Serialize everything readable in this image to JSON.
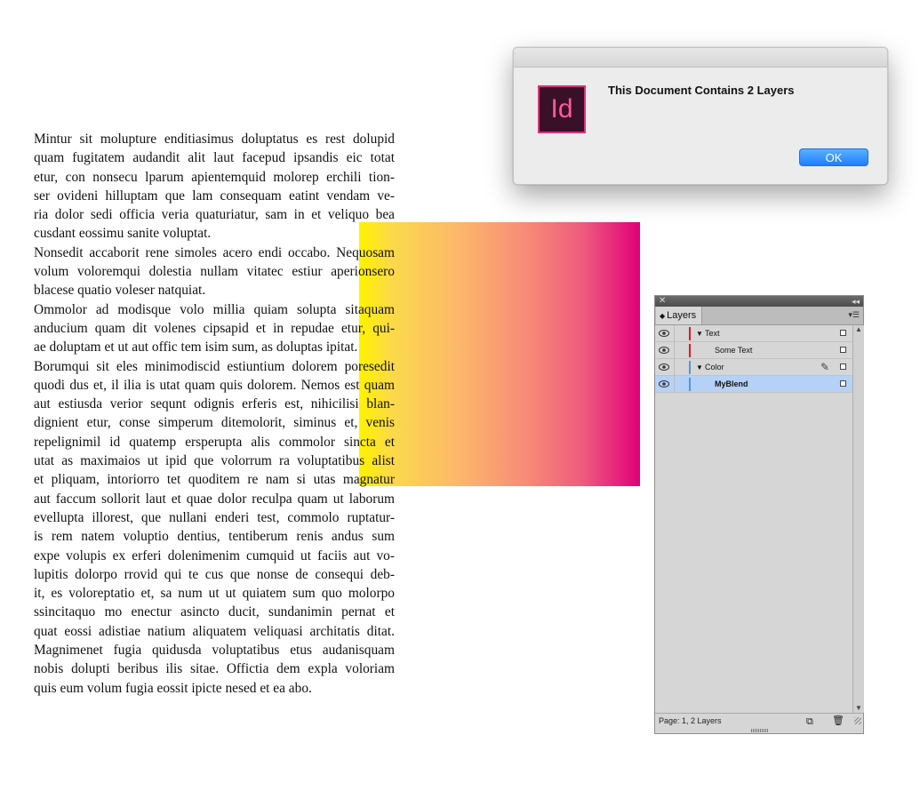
{
  "document": {
    "text_lines": [
      "Mintur sit molupture enditiasimus doluptatus es rest dolupid",
      "quam fugitatem audandit alit laut facepud ipsandis eic totat",
      "etur, con nonsecu lparum apientemquid molorep erchili tion-",
      "ser ovideni hilluptam que lam consequam eatint vendam ve-",
      "ria dolor sedi officia veria quaturiatur, sam in et veliquo bea",
      "cusdant eossimu sanite voluptat.",
      "Nonsedit accaborit rene simoles acero endi occabo. Nequosam",
      "volum voloremqui dolestia nullam vitatec estiur aperionsero",
      "blacese quatio voleser natquiat.",
      "Ommolor ad modisque volo millia quiam solupta sitaquam",
      "anducium quam dit volenes cipsapid et in repudae etur, qui-",
      "ae doluptam et ut aut offic tem isim sum, as doluptas ipitat.",
      "Borumqui sit eles minimodiscid estiuntium dolorem poresedit",
      "quodi dus et, il ilia is utat quam quis dolorem. Nemos est quam",
      "aut estiusda verior sequnt odignis erferis est, nihicilisi blan-",
      "dignient etur, conse simperum ditemolorit, siminus et, venis",
      "repelignimil id quatemp ersperupta alis commolor sincta et",
      "utat as maximaios ut ipid que volorrum ra voluptatibus alist",
      "et pliquam, intoriorro tet quoditem re nam si utas magnatur",
      "aut faccum sollorit laut et quae dolor reculpa quam ut laborum",
      "evellupta illorest, que nullani enderi test, commolo ruptatur-",
      "is rem natem voluptio dentius, tentiberum renis andus sum",
      "expe volupis ex erferi dolenimenim cumquid ut faciis aut vo-",
      "lupitis dolorpo rrovid qui te cus que nonse de consequi deb-",
      "it, es voloreptatio et, sa num ut ut quiatem sum quo molorpo",
      "ssincitaquo mo enectur asincto ducit, sundanimin pernat et",
      "quat eossi adistiae natium aliquatem veliquasi architatis ditat.",
      "Magnimenet fugia quidusda voluptatibus etus audanisquam",
      "nobis dolupti beribus ilis sitae. Offictia dem expla voloriam",
      "quis eum volum fugia eossit ipicte nesed et ea abo."
    ],
    "paragraph_ends": [
      5,
      8,
      11,
      29
    ],
    "blend_colors": [
      "#fff200",
      "#e0007a"
    ]
  },
  "dialog": {
    "app_icon_text": "Id",
    "message": "This Document Contains 2 Layers",
    "ok_label": "OK"
  },
  "layers_panel": {
    "tab_label": "Layers",
    "rows": [
      {
        "label": "Text",
        "indent": 0,
        "expanded": true,
        "color": "#e8141e",
        "selected": false,
        "bold": false,
        "pen": false
      },
      {
        "label": "Some Text",
        "indent": 1,
        "expanded": false,
        "color": "#e8141e",
        "selected": false,
        "bold": false,
        "pen": false
      },
      {
        "label": "Color",
        "indent": 0,
        "expanded": true,
        "color": "#4f95e6",
        "selected": false,
        "bold": false,
        "pen": true
      },
      {
        "label": "MyBlend",
        "indent": 1,
        "expanded": false,
        "color": "#4f95e6",
        "selected": true,
        "bold": true,
        "pen": false
      }
    ],
    "status": "Page: 1, 2 Layers"
  }
}
